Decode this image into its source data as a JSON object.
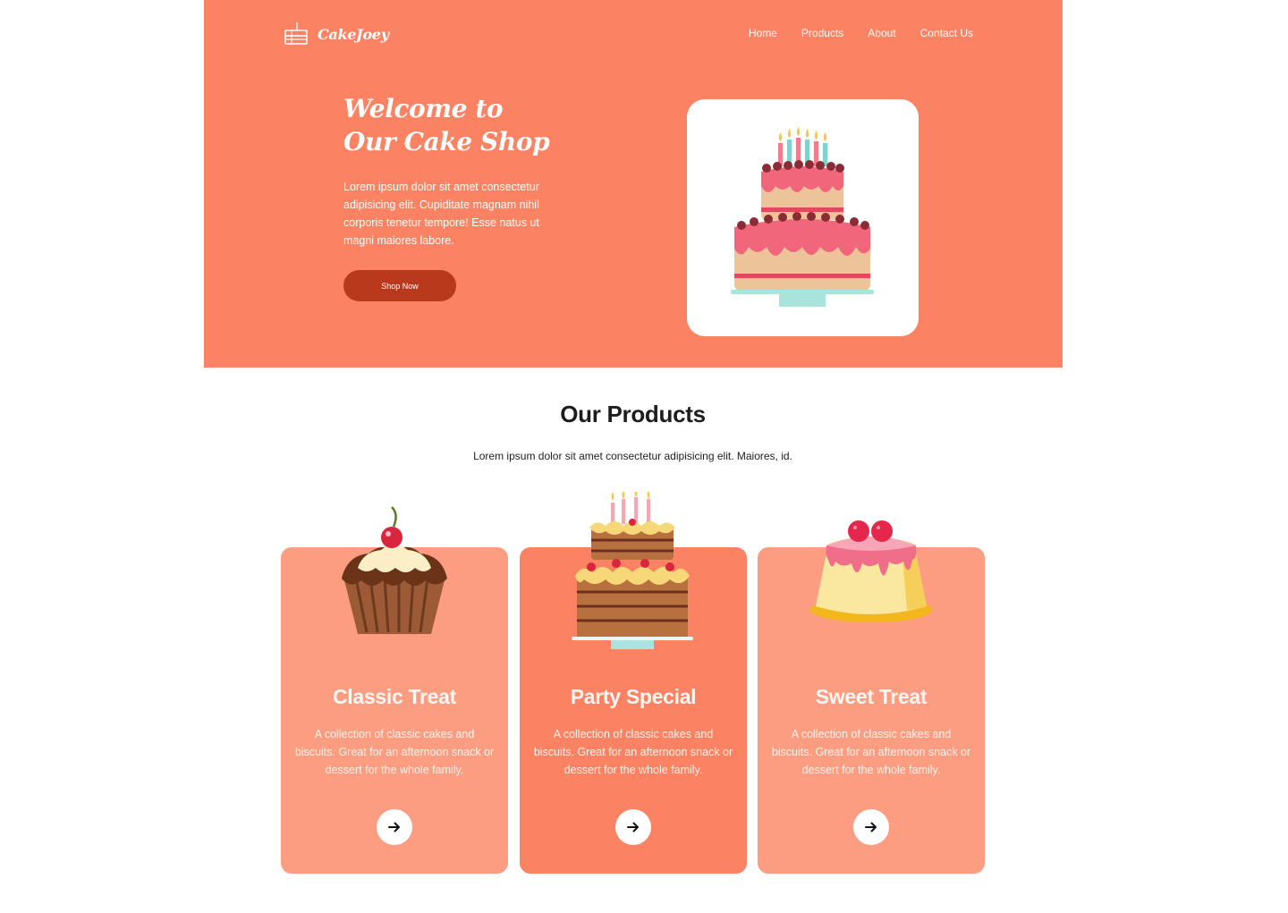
{
  "brand": {
    "name": "CakeJoey"
  },
  "nav": {
    "items": [
      "Home",
      "Products",
      "About",
      "Contact Us"
    ]
  },
  "hero": {
    "title_line1": "Welcome to",
    "title_line2": "Our Cake Shop",
    "text": "Lorem ipsum dolor sit amet consectetur adipisicing elit. Cupiditate magnam nihil corporis tenetur tempore! Esse natus ut magni maiores labore.",
    "button_label": "Shop Now"
  },
  "products": {
    "title": "Our Products",
    "subtitle": "Lorem ipsum dolor sit amet consectetur adipisicing elit. Maiores, id.",
    "cards": [
      {
        "title": "Classic Treat",
        "description": "A collection of classic cakes and biscuits. Great for an afternoon snack or dessert for the whole family."
      },
      {
        "title": "Party Special",
        "description": "A collection of classic cakes and biscuits. Great for an afternoon snack or dessert for the whole family."
      },
      {
        "title": "Sweet Treat",
        "description": "A collection of classic cakes and biscuits. Great for an afternoon snack or dessert for the whole family."
      }
    ]
  },
  "icons": {
    "logo": "cake-slice-icon",
    "card_button": "arrow-right-icon"
  },
  "colors": {
    "hero_bg": "#fb8262",
    "card_bg": "#fc9d82",
    "card_featured_bg": "#fb8262",
    "button_bg": "#b9391c",
    "white": "#ffffff"
  }
}
